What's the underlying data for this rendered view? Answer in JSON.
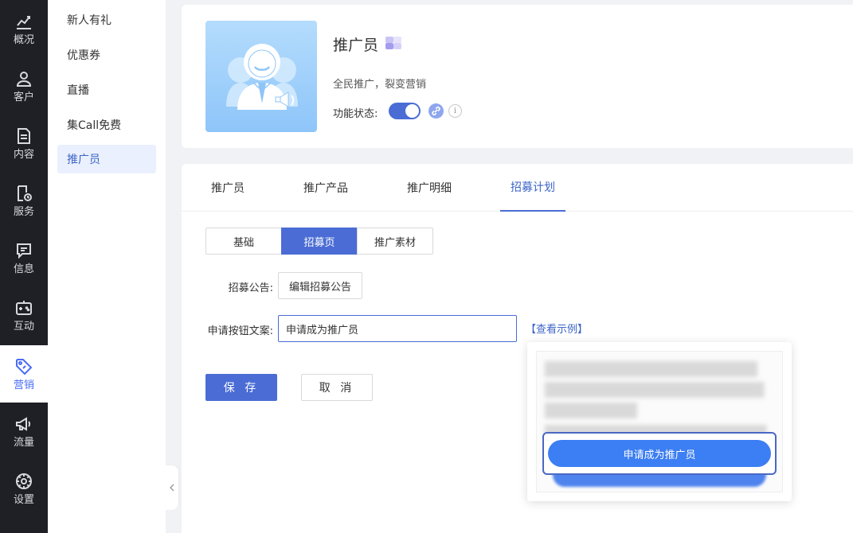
{
  "rail": {
    "items": [
      {
        "label": "概况",
        "icon": "chart-line-icon"
      },
      {
        "label": "客户",
        "icon": "user-icon"
      },
      {
        "label": "内容",
        "icon": "document-icon"
      },
      {
        "label": "服务",
        "icon": "service-clock-icon"
      },
      {
        "label": "信息",
        "icon": "message-icon"
      },
      {
        "label": "互动",
        "icon": "gamepad-icon"
      },
      {
        "label": "营销",
        "icon": "tag-icon",
        "active": true
      },
      {
        "label": "流量",
        "icon": "megaphone-icon"
      },
      {
        "label": "设置",
        "icon": "settings-icon"
      }
    ]
  },
  "subnav": {
    "items": [
      {
        "label": "新人有礼"
      },
      {
        "label": "优惠券"
      },
      {
        "label": "直播"
      },
      {
        "label": "集Call免费"
      },
      {
        "label": "推广员",
        "active": true
      }
    ]
  },
  "feature": {
    "title": "推广员",
    "description": "全民推广，裂变营销",
    "status_label": "功能状态:",
    "enabled": true,
    "info_glyph": "i"
  },
  "tabs": [
    {
      "label": "推广员"
    },
    {
      "label": "推广产品"
    },
    {
      "label": "推广明细"
    },
    {
      "label": "招募计划",
      "active": true
    }
  ],
  "segments": [
    {
      "label": "基础"
    },
    {
      "label": "招募页",
      "active": true
    },
    {
      "label": "推广素材"
    }
  ],
  "form": {
    "announcement_label": "招募公告:",
    "edit_announcement_button": "编辑招募公告",
    "button_text_label": "申请按钮文案:",
    "button_text_value": "申请成为推广员",
    "view_example_link": "【查看示例】",
    "save_button": "保 存",
    "cancel_button": "取 消"
  },
  "example_popover": {
    "apply_button_label": "申请成为推广员"
  },
  "colors": {
    "primary": "#4a6cd4",
    "rail_bg": "#1e2025",
    "link": "#3c64c8",
    "apply_button": "#3c7ef3"
  }
}
